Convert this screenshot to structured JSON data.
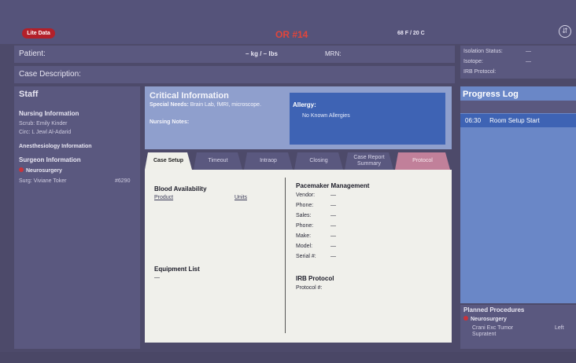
{
  "header": {
    "logo_text": "Lite Data",
    "room": "OR #14",
    "temp": "68 F / 20 C"
  },
  "patient": {
    "label": "Patient:",
    "weight": "– kg / – lbs",
    "mrn_label": "MRN:"
  },
  "isolation": {
    "status": "Isolation Status:",
    "status_value": "—",
    "isotope": "Isotope:",
    "isotope_value": "—",
    "irb": "IRB Protocol:"
  },
  "case": {
    "label": "Case Description:"
  },
  "staff": {
    "title": "Staff",
    "nursing_title": "Nursing Information",
    "scrub": "Scrub:   Emily Kinder",
    "circ": "Circ:    L Jewl Al-Adarid",
    "anesthesia_title": "Anesthesiology Information",
    "surgeon_title": "Surgeon Information",
    "specialty": "Neurosurgery",
    "surg_name": "Surg:   Viviane Toker",
    "surg_ext": "#6290"
  },
  "critical": {
    "title": "Critical Information",
    "special_label": "Special Needs:",
    "special_value": "Brain Lab, fMRI, microscope.",
    "nursing_notes": "Nursing Notes:",
    "allergy_title": "Allergy:",
    "allergy_value": "No Known Allergies"
  },
  "tabs": {
    "case_setup": "Case Setup",
    "timeout": "Timeout",
    "intraop": "Intraop",
    "closing": "Closing",
    "summary": "Case Report Summary",
    "protocol": "Protocol"
  },
  "content": {
    "blood_title": "Blood Availability",
    "product": "Product",
    "units": "Units",
    "equipment_title": "Equipment List",
    "equipment_value": "—",
    "pacemaker_title": "Pacemaker Management",
    "pm_fields": [
      {
        "label": "Vendor:",
        "value": "—"
      },
      {
        "label": "Phone:",
        "value": "—"
      },
      {
        "label": "Sales:",
        "value": "—"
      },
      {
        "label": "Phone:",
        "value": "—"
      },
      {
        "label": "Make:",
        "value": "—"
      },
      {
        "label": "Model:",
        "value": "—"
      },
      {
        "label": "Serial #:",
        "value": "—"
      }
    ],
    "irb_title": "IRB Protocol",
    "protocol_label": "Protocol #:"
  },
  "progress": {
    "title": "Progress Log",
    "entry_time": "06:30",
    "entry_text": "Room Setup Start"
  },
  "planned": {
    "title": "Planned Procedures",
    "specialty": "Neurosurgery",
    "procedure_line1": "Crani Exc Tumor",
    "procedure_line2": "Supratent",
    "side": "Left"
  }
}
